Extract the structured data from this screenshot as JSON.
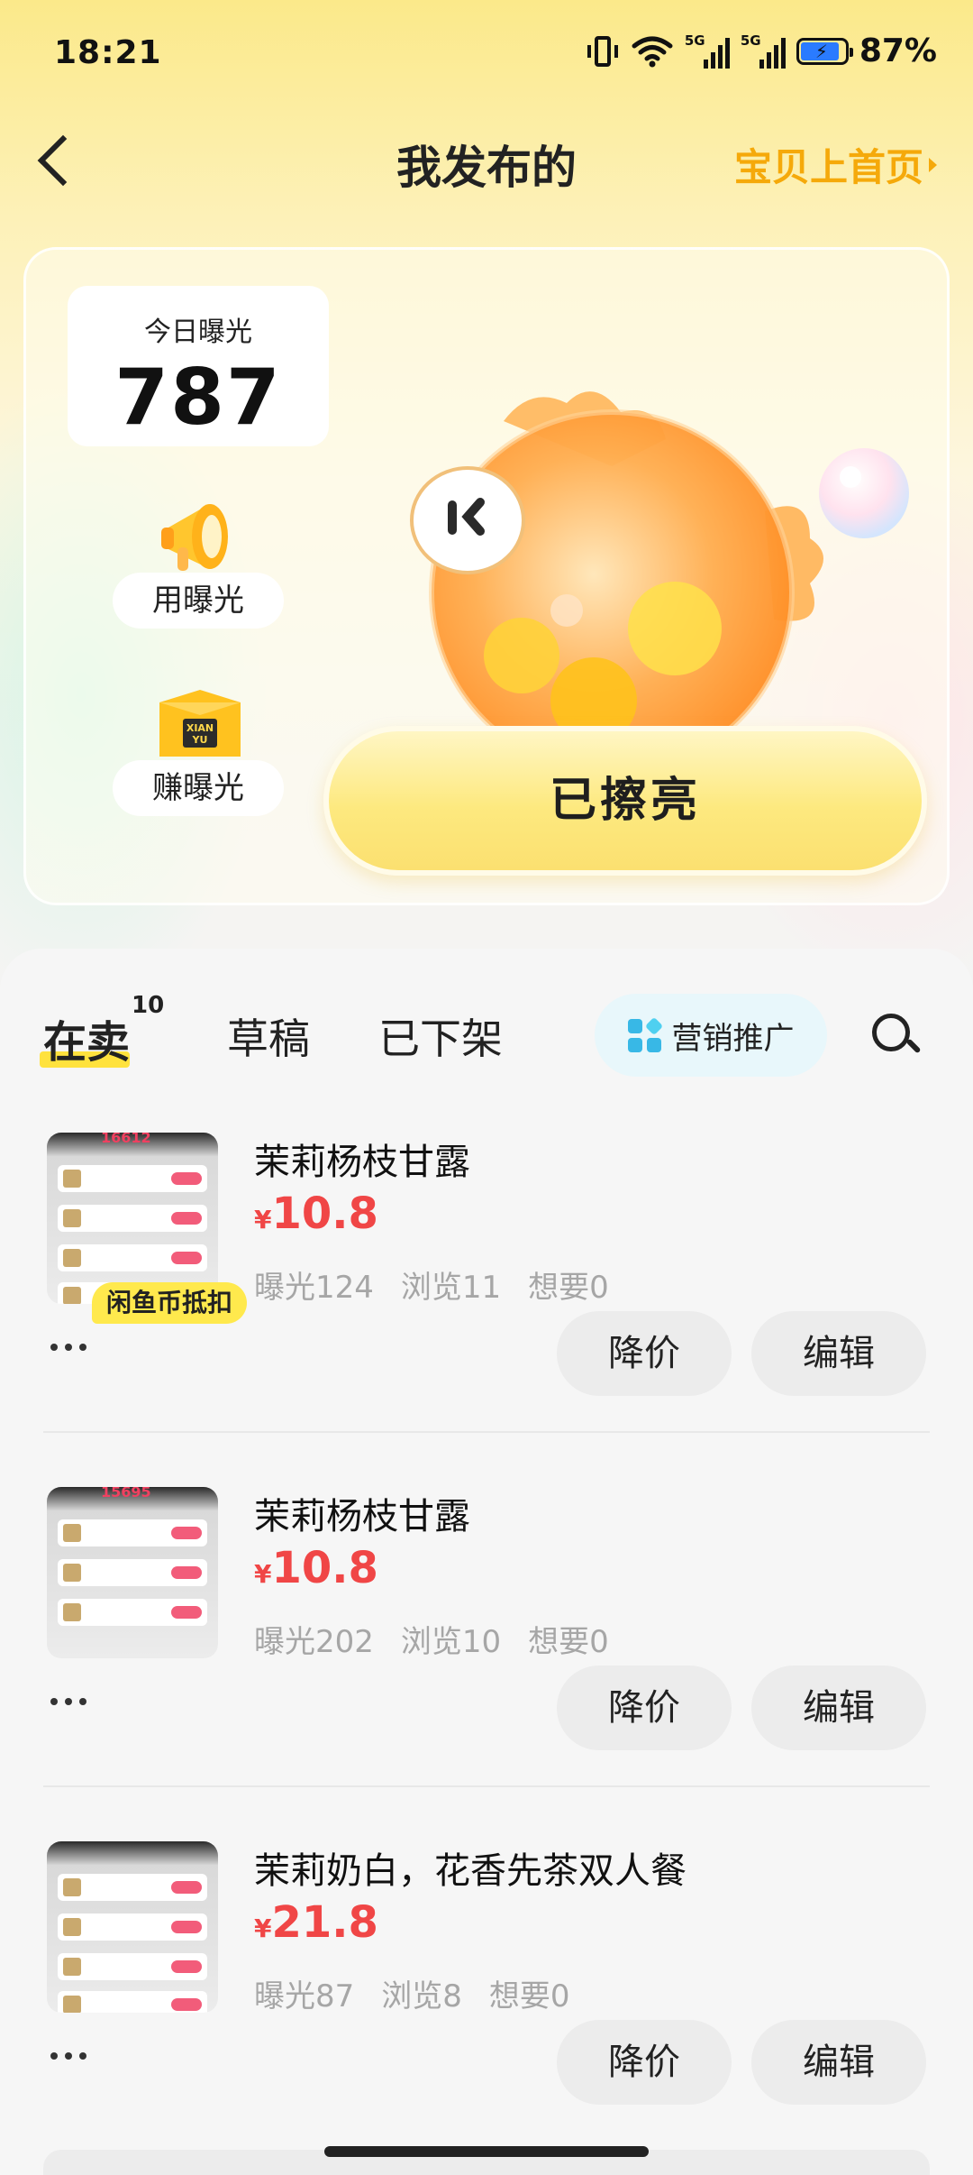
{
  "status_bar": {
    "time": "18:21",
    "signal1_tag": "5G",
    "signal2_tag": "5G",
    "battery_percent": "87%",
    "icons": [
      "vibrate-icon",
      "wifi-icon",
      "signal-icon",
      "signal-icon",
      "battery-charging-icon"
    ]
  },
  "nav": {
    "title": "我发布的",
    "link": "宝贝上首页",
    "back_icon": "chevron-left-icon"
  },
  "exposure": {
    "today_label": "今日曝光",
    "today_value": "787",
    "use_label": "用曝光",
    "earn_label": "赚曝光",
    "shine_button": "已擦亮",
    "box_text": "XIAN YU",
    "mascot": "pufferfish-mascot-illustration"
  },
  "tabs": {
    "selling": "在卖",
    "selling_count": "10",
    "draft": "草稿",
    "off_shelf": "已下架",
    "promo": "营销推广",
    "search_icon": "search-icon"
  },
  "items": [
    {
      "title": "茉莉杨枝甘露",
      "currency": "¥",
      "price": "10.8",
      "stats": [
        "曝光124",
        "浏览11",
        "想要0"
      ],
      "badge": "闲鱼币抵扣",
      "buttons": [
        "降价",
        "编辑"
      ]
    },
    {
      "title": "茉莉杨枝甘露",
      "currency": "¥",
      "price": "10.8",
      "stats": [
        "曝光202",
        "浏览10",
        "想要0"
      ],
      "buttons": [
        "降价",
        "编辑"
      ]
    },
    {
      "title": "茉莉奶白，花香先茶双人餐",
      "currency": "¥",
      "price": "21.8",
      "stats": [
        "曝光87",
        "浏览8",
        "想要0"
      ],
      "buttons": [
        "降价",
        "编辑"
      ]
    }
  ],
  "colors": {
    "accent_yellow": "#ffe23d",
    "price_red": "#f04646",
    "link_orange": "#f5a90a",
    "promo_bg": "#e8f7fb"
  }
}
